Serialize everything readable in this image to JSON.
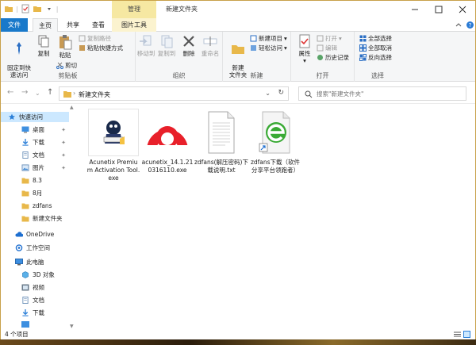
{
  "window": {
    "title": "新建文件夹",
    "context_tab_group": "管理"
  },
  "tabs": [
    {
      "label": "文件"
    },
    {
      "label": "主页"
    },
    {
      "label": "共享"
    },
    {
      "label": "查看"
    },
    {
      "label": "图片工具"
    }
  ],
  "ribbon": {
    "clipboard": {
      "label": "剪贴板",
      "pin": "固定到快\n速访问",
      "copy": "复制",
      "paste": "粘贴",
      "copy_path": "复制路径",
      "paste_shortcut": "粘贴快捷方式",
      "cut": "剪切"
    },
    "organize": {
      "label": "组织",
      "move_to": "移动到",
      "copy_to": "复制到",
      "delete": "删除",
      "rename": "重命名"
    },
    "new": {
      "label": "新建",
      "new_folder": "新建\n文件夹",
      "new_item": "新建项目",
      "easy_access": "轻松访问"
    },
    "open": {
      "label": "打开",
      "properties": "属性",
      "open": "打开",
      "edit": "编辑",
      "history": "历史记录"
    },
    "select": {
      "label": "选择",
      "select_all": "全部选择",
      "select_none": "全部取消",
      "invert": "反向选择"
    }
  },
  "address": {
    "path": "新建文件夹",
    "search_placeholder": "搜索\"新建文件夹\""
  },
  "nav": {
    "items": [
      {
        "label": "快速访问"
      },
      {
        "label": "桌面"
      },
      {
        "label": "下载"
      },
      {
        "label": "文档"
      },
      {
        "label": "图片"
      },
      {
        "label": "8.3"
      },
      {
        "label": "8月"
      },
      {
        "label": "zdfans"
      },
      {
        "label": "新建文件夹"
      },
      {
        "label": "OneDrive"
      },
      {
        "label": "工作空间"
      },
      {
        "label": "此电脑"
      },
      {
        "label": "3D 对象"
      },
      {
        "label": "视频"
      },
      {
        "label": "文档"
      },
      {
        "label": "下载"
      }
    ]
  },
  "files": [
    {
      "name": "Acunetix Premium Activation Tool.exe"
    },
    {
      "name": "acunetix_14.1.210316110.exe"
    },
    {
      "name": "zdfans(解压密码)下载说明.txt"
    },
    {
      "name": "zdfans下载（软件分享平台领跑者）"
    }
  ],
  "status": {
    "count": "4 个项目"
  },
  "colors": {
    "file_tab": "#1979ca",
    "context_tab": "#f6e8a2",
    "selection": "#cce8ff"
  }
}
